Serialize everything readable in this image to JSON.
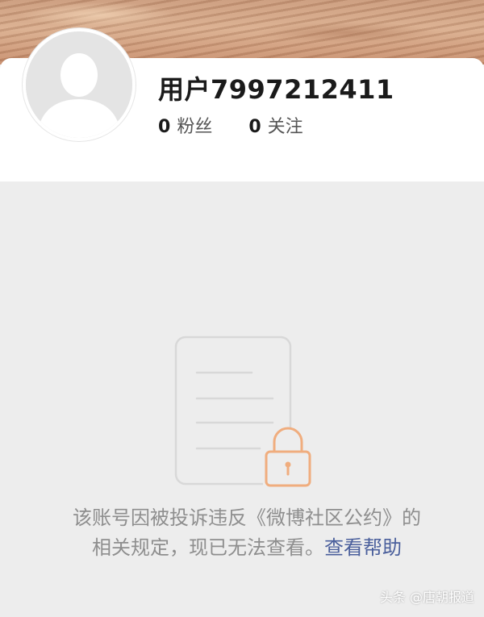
{
  "profile": {
    "username": "用户7997212411",
    "followers": {
      "count": "0",
      "label": "粉丝"
    },
    "following": {
      "count": "0",
      "label": "关注"
    }
  },
  "notice": {
    "message": "该账号因被投诉违反《微博社区公约》的相关规定，现已无法查看。",
    "help_link": "查看帮助"
  },
  "icons": {
    "avatar": "default-avatar-icon",
    "illustration": "locked-document-icon"
  },
  "colors": {
    "background": "#ededed",
    "card": "#ffffff",
    "text_muted": "#8e8e8e",
    "link": "#4a5f9c",
    "lock_accent": "#f0ad7e",
    "document_line": "#d8d8d8"
  },
  "watermark": "头条 @唐朝报道"
}
